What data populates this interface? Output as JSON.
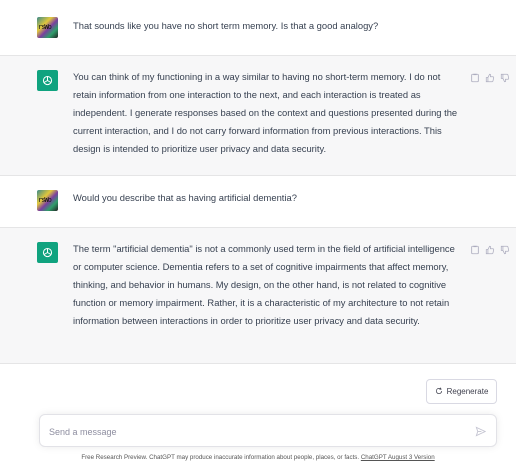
{
  "conversation": [
    {
      "role": "user",
      "avatar_icon": "user-avatar-image",
      "text": "That sounds like you have no short term memory. Is that a good analogy?"
    },
    {
      "role": "assistant",
      "avatar_icon": "openai-logo-icon",
      "text": "You can think of my functioning in a way similar to having no short-term memory. I do not retain information from one interaction to the next, and each interaction is treated as independent. I generate responses based on the context and questions presented during the current interaction, and I do not carry forward information from previous interactions. This design is intended to prioritize user privacy and data security."
    },
    {
      "role": "user",
      "avatar_icon": "user-avatar-image",
      "text": "Would you describe that as having artificial dementia?"
    },
    {
      "role": "assistant",
      "avatar_icon": "openai-logo-icon",
      "text": "The term \"artificial dementia\" is not a commonly used term in the field of artificial intelligence or computer science. Dementia refers to a set of cognitive impairments that affect memory, thinking, and behavior in humans. My design, on the other hand, is not related to cognitive function or memory impairment. Rather, it is a characteristic of my architecture to not retain information between interactions in order to prioritize user privacy and data security."
    }
  ],
  "message_actions": [
    "copy-icon",
    "thumbs-up-icon",
    "thumbs-down-icon"
  ],
  "regenerate": {
    "label": "Regenerate",
    "icon": "refresh-icon"
  },
  "composer": {
    "placeholder": "Send a message",
    "send_icon": "send-icon"
  },
  "footer": {
    "text": "Free Research Preview. ChatGPT may produce inaccurate information about people, places, or facts. ",
    "link": "ChatGPT August 3 Version"
  },
  "colors": {
    "assistant_bg": "#f7f7f8",
    "brand_green": "#10a37f",
    "text": "#374151",
    "border": "#e5e5e6"
  }
}
